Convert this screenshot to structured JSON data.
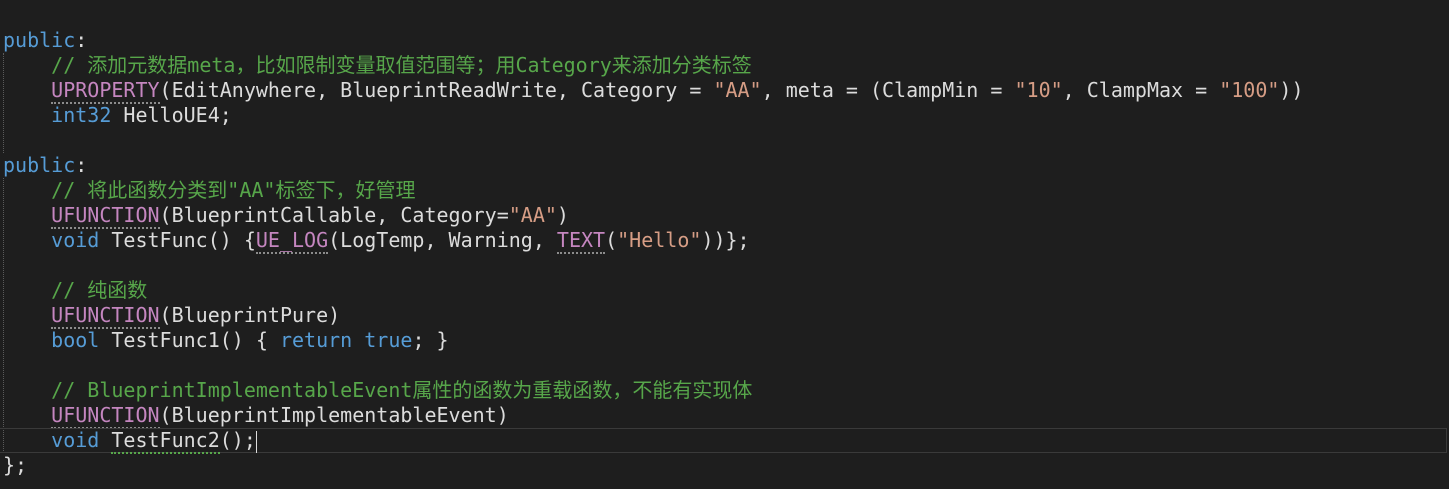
{
  "colors": {
    "background": "#1e1e1e",
    "keyword": "#569cd6",
    "macro": "#c586c0",
    "string": "#d69d85",
    "comment": "#57a64a",
    "text": "#dcdcdc"
  },
  "code": {
    "l1": {
      "kw": "public",
      "rest": ":"
    },
    "l2": {
      "indent": "    ",
      "comment": "// 添加元数据meta，比如限制变量取值范围等；用Category来添加分类标签"
    },
    "l3": {
      "indent": "    ",
      "macro": "UPROPERTY",
      "t1": "(EditAnywhere, BlueprintReadWrite, Category = ",
      "s1": "\"AA\"",
      "t2": ", meta = (ClampMin = ",
      "s2": "\"10\"",
      "t3": ", ClampMax = ",
      "s3": "\"100\"",
      "t4": "))"
    },
    "l4": {
      "indent": "    ",
      "kw": "int32",
      "rest": " HelloUE4;"
    },
    "l5": {
      "text": ""
    },
    "l6": {
      "kw": "public",
      "rest": ":"
    },
    "l7": {
      "indent": "    ",
      "comment": "// 将此函数分类到\"AA\"标签下，好管理"
    },
    "l8": {
      "indent": "    ",
      "macro": "UFUNCTION",
      "t1": "(BlueprintCallable, Category=",
      "s1": "\"AA\"",
      "t2": ")"
    },
    "l9": {
      "indent": "    ",
      "kw": "void",
      "t1": " TestFunc() {",
      "macro1": "UE_LOG",
      "t2": "(LogTemp, Warning, ",
      "macro2": "TEXT",
      "t3": "(",
      "s1": "\"Hello\"",
      "t4": "))};"
    },
    "l10": {
      "text": ""
    },
    "l11": {
      "indent": "    ",
      "comment": "// 纯函数"
    },
    "l12": {
      "indent": "    ",
      "macro": "UFUNCTION",
      "t1": "(BlueprintPure)"
    },
    "l13": {
      "indent": "    ",
      "kw": "bool",
      "t1": " TestFunc1() { ",
      "kw2": "return",
      "t2": " ",
      "kw3": "true",
      "t3": "; }"
    },
    "l14": {
      "text": ""
    },
    "l15": {
      "indent": "    ",
      "comment": "// BlueprintImplementableEvent属性的函数为重载函数，不能有实现体"
    },
    "l16": {
      "indent": "    ",
      "macro": "UFUNCTION",
      "t1": "(BlueprintImplementableEvent)"
    },
    "l17": {
      "indent": "    ",
      "kw": "void",
      "t1": " ",
      "fn": "TestFunc2",
      "t2": "();"
    },
    "l18": {
      "text": "};"
    }
  }
}
